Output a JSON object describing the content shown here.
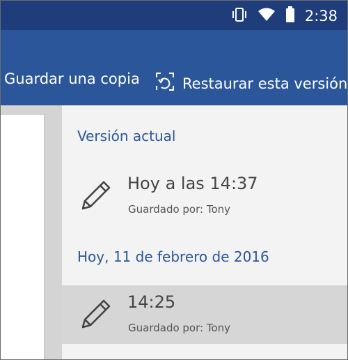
{
  "status_bar": {
    "time": "2:38",
    "icons": [
      "vibrate-icon",
      "wifi-icon",
      "battery-icon"
    ]
  },
  "toolbar": {
    "save_copy_label": "Guardar una copia",
    "restore_label": "Restaurar esta versión",
    "restore_icon": "restore-version-icon"
  },
  "versions": {
    "current_header": "Versión actual",
    "current": {
      "time": "Hoy a las 14:37",
      "saved_by": "Guardado por: Tony",
      "icon": "pencil-icon"
    },
    "date_header": "Hoy, 11 de febrero de 2016",
    "items": [
      {
        "time": "14:25",
        "saved_by": "Guardado por: Tony",
        "icon": "pencil-icon",
        "selected": true
      }
    ]
  },
  "colors": {
    "status_bar": "#1f3d7a",
    "toolbar": "#2b579a",
    "header_text": "#2b579a",
    "panel_bg": "#f3f3f3",
    "selected_bg": "#d6d6d6"
  }
}
